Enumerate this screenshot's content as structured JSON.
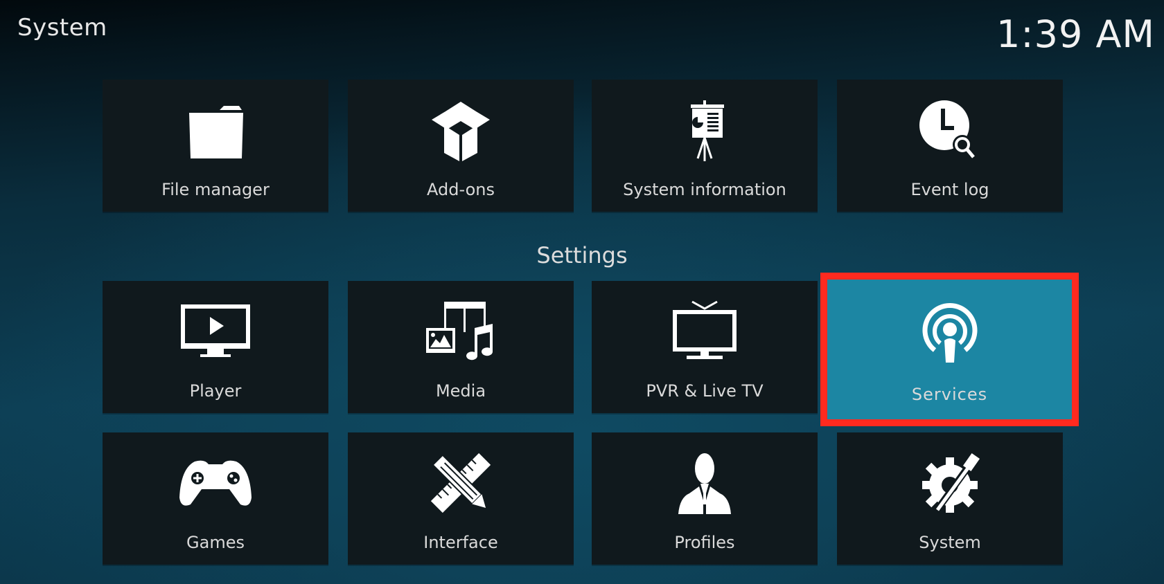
{
  "header": {
    "title": "System",
    "clock": "1:39 AM"
  },
  "top_row": [
    {
      "label": "File manager",
      "icon": "folder-icon"
    },
    {
      "label": "Add-ons",
      "icon": "open-box-icon"
    },
    {
      "label": "System information",
      "icon": "presentation-easel-icon"
    },
    {
      "label": "Event log",
      "icon": "clock-search-icon"
    }
  ],
  "settings": {
    "section_label": "Settings",
    "items": [
      {
        "label": "Player",
        "icon": "monitor-play-icon"
      },
      {
        "label": "Media",
        "icon": "media-film-music-icon"
      },
      {
        "label": "PVR & Live TV",
        "icon": "tv-antenna-icon"
      },
      {
        "label": "Services",
        "icon": "broadcast-podcast-icon",
        "focused": true
      },
      {
        "label": "Games",
        "icon": "gamepad-icon"
      },
      {
        "label": "Interface",
        "icon": "ruler-pencil-icon"
      },
      {
        "label": "Profiles",
        "icon": "person-icon"
      },
      {
        "label": "System",
        "icon": "gear-wrench-icon"
      }
    ]
  },
  "colors": {
    "focus_tile": "#1c86a3",
    "highlight_border": "#ff2a1f",
    "tile_background": "#10191d"
  }
}
